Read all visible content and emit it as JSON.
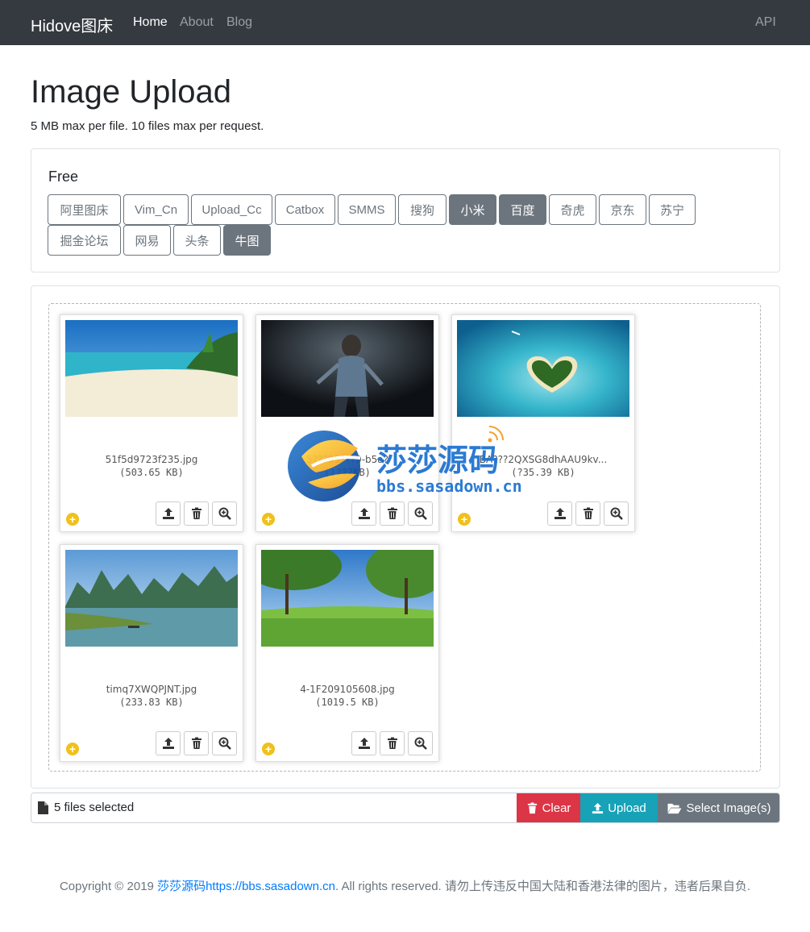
{
  "navbar": {
    "brand": "Hidove图床",
    "links": [
      "Home",
      "About",
      "Blog"
    ],
    "api": "API"
  },
  "page": {
    "title": "Image Upload",
    "subtitle": "5 MB max per file. 10 files max per request."
  },
  "hosts": {
    "title": "Free",
    "buttons": [
      {
        "label": "阿里图床",
        "active": false
      },
      {
        "label": "Vim_Cn",
        "active": false
      },
      {
        "label": "Upload_Cc",
        "active": false
      },
      {
        "label": "Catbox",
        "active": false
      },
      {
        "label": "SMMS",
        "active": false
      },
      {
        "label": "搜狗",
        "active": false
      },
      {
        "label": "小米",
        "active": true
      },
      {
        "label": "百度",
        "active": true
      },
      {
        "label": "奇虎",
        "active": false
      },
      {
        "label": "京东",
        "active": false
      },
      {
        "label": "苏宁",
        "active": false
      },
      {
        "label": "掘金论坛",
        "active": false
      },
      {
        "label": "网易",
        "active": false
      },
      {
        "label": "头条",
        "active": false
      },
      {
        "label": "牛图",
        "active": true
      }
    ]
  },
  "files": [
    {
      "name": "51f5d9723f235.jpg",
      "size": "(503.65 KB)",
      "scene": "beach"
    },
    {
      "name": "5???95???9-b5a?",
      "size": "(1???KB)",
      "scene": "dark"
    },
    {
      "name": "BA???2QXSG8dhAAU9kv...",
      "size": "(?35.39 KB)",
      "scene": "island"
    },
    {
      "name": "timq7XWQPJNT.jpg",
      "size": "(233.83 KB)",
      "scene": "river"
    },
    {
      "name": "4-1F209105608.jpg",
      "size": "(1019.5 KB)",
      "scene": "meadow"
    }
  ],
  "filebar": {
    "caption": "5 files selected",
    "clear": "Clear",
    "upload": "Upload",
    "select": "Select Image(s)"
  },
  "footer": {
    "prefix": "Copyright © 2019 ",
    "link": "莎莎源码https://bbs.sasadown.cn",
    "suffix": ". All rights reserved. 请勿上传违反中国大陆和香港法律的图片，违者后果自负."
  },
  "watermark": {
    "title": "莎莎源码",
    "url": "bbs.sasadown.cn"
  },
  "colors": {
    "navbar": "#343a40",
    "secondary": "#6c757d",
    "danger": "#dc3545",
    "info": "#17a2b8",
    "link": "#007bff"
  }
}
